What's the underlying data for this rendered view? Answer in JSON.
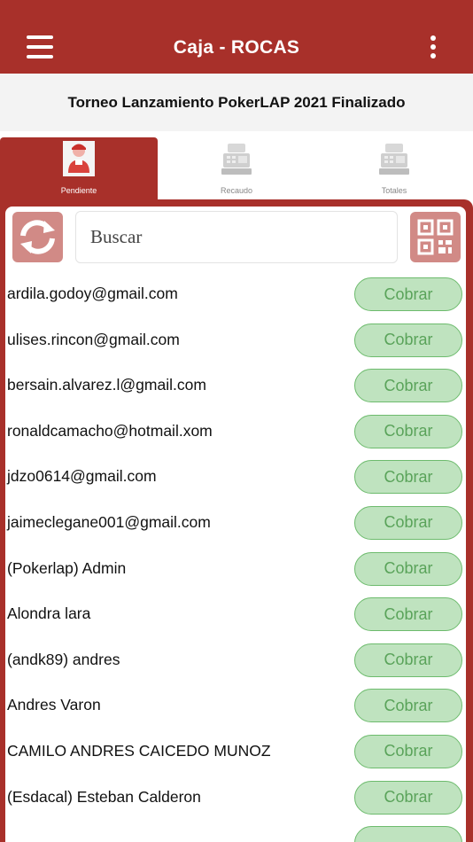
{
  "header": {
    "title": "Caja - ROCAS",
    "accent": "#a8302a"
  },
  "tournament": {
    "title": "Torneo Lanzamiento PokerLAP 2021 Finalizado"
  },
  "tabs": [
    {
      "label": "Pendiente",
      "icon": "cashier-person-icon",
      "active": true
    },
    {
      "label": "Recaudo",
      "icon": "cash-register-icon",
      "active": false
    },
    {
      "label": "Totales",
      "icon": "cash-register-icon",
      "active": false
    }
  ],
  "search": {
    "placeholder": "Buscar"
  },
  "action_label": "Cobrar",
  "players": [
    {
      "name": "ardila.godoy@gmail.com"
    },
    {
      "name": "ulises.rincon@gmail.com"
    },
    {
      "name": "bersain.alvarez.l@gmail.com"
    },
    {
      "name": "ronaldcamacho@hotmail.xom"
    },
    {
      "name": "jdzo0614@gmail.com"
    },
    {
      "name": "jaimeclegane001@gmail.com"
    },
    {
      "name": "(Pokerlap) Admin"
    },
    {
      "name": "Alondra lara"
    },
    {
      "name": "(andk89) andres"
    },
    {
      "name": "Andres Varon"
    },
    {
      "name": "CAMILO ANDRES CAICEDO MUNOZ"
    },
    {
      "name": "(Esdacal) Esteban Calderon"
    },
    {
      "name": ""
    }
  ]
}
